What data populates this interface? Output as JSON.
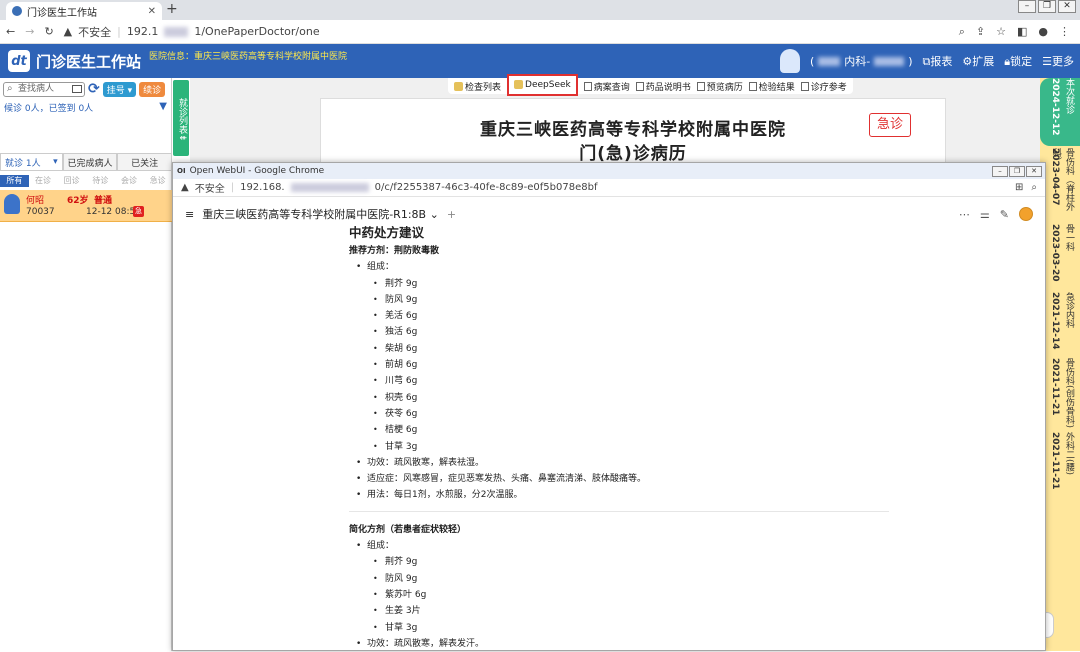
{
  "browser": {
    "tab_title": "门诊医生工作站",
    "url_warning": "不安全",
    "url_prefix": "192.1",
    "url_suffix": "1/OnePaperDoctor/one"
  },
  "app": {
    "title": "门诊医生工作站",
    "hospital_info": "医院信息：重庆三峡医药高等专科学校附属中医院",
    "dept": "内科-",
    "dept_close": ")",
    "actions": [
      "报表",
      "扩展",
      "锁定",
      "更多"
    ]
  },
  "left": {
    "search_placeholder": "查找病人",
    "register_btn": "挂号 ▾",
    "revisit_btn": "续诊",
    "wait_line": "候诊 0人，已签到 0人",
    "status_tabs": [
      "就诊 1人",
      "已完成病人",
      "已关注"
    ],
    "filters": [
      "所有",
      "在诊",
      "回诊",
      "待诊",
      "会诊",
      "急诊"
    ],
    "patient": {
      "name": "何昭",
      "age": "62岁",
      "type": "普通",
      "id": "70037",
      "date": "12-12 08:57",
      "badge": "急"
    }
  },
  "strip": {
    "label": "就诊列表⇟"
  },
  "toolbar": {
    "items": [
      "检查列表",
      "DeepSeek",
      "病案查询",
      "药品说明书",
      "预览病历",
      "检验结果",
      "诊疗参考"
    ]
  },
  "paper": {
    "hospital": "重庆三峡医药高等专科学校附属中医院",
    "record_title": "门(急)诊病历",
    "emergency": "急诊"
  },
  "rail": {
    "items": [
      {
        "date": "2024-12-12",
        "dept": "本次就诊"
      },
      {
        "date": "2023-04-07",
        "dept": "骨伤科（脊柱外科）"
      },
      {
        "date": "2023-03-20",
        "dept": "骨一科"
      },
      {
        "date": "2021-12-14",
        "dept": "急诊内科"
      },
      {
        "date": "2021-11-21",
        "dept": "骨伤科(创伤骨科)"
      },
      {
        "date": "2021-11-21",
        "dept": "外科二(腰)"
      }
    ]
  },
  "popup": {
    "window_title": "Open WebUI - Google Chrome",
    "window_icon": "OI",
    "url_warning": "不安全",
    "url_prefix": "192.168.",
    "url_suffix": "0/c/f2255387-46c3-40fe-8c89-e0f5b078e8bf",
    "chat_title": "重庆三峡医药高等专科学校附属中医院-R1:8B",
    "chevron": "⌄",
    "plus": "+"
  },
  "content": {
    "heading": "中药处方建议",
    "rec_label": "推荐方剂：荆防败毒散",
    "rec_components_label": "组成：",
    "rec_herbs": [
      "荆芥 9g",
      "防风 9g",
      "羌活 6g",
      "独活 6g",
      "柴胡 6g",
      "前胡 6g",
      "川芎 6g",
      "枳壳 6g",
      "茯苓 6g",
      "桔梗 6g",
      "甘草 3g"
    ],
    "rec_effect": "功效：疏风散寒，解表祛湿。",
    "rec_indication": "适应症：风寒感冒，症见恶寒发热、头痛、鼻塞流清涕、肢体酸痛等。",
    "rec_usage": "用法：每日1剂，水煎服，分2次温服。",
    "simple_label": "简化方剂（若患者症状较轻）",
    "simple_components_label": "组成：",
    "simple_herbs": [
      "荆芥 9g",
      "防风 9g",
      "紫苏叶 6g",
      "生姜 3片",
      "甘草 3g"
    ],
    "simple_effect": "功效：疏风散寒，解表发汗。"
  }
}
